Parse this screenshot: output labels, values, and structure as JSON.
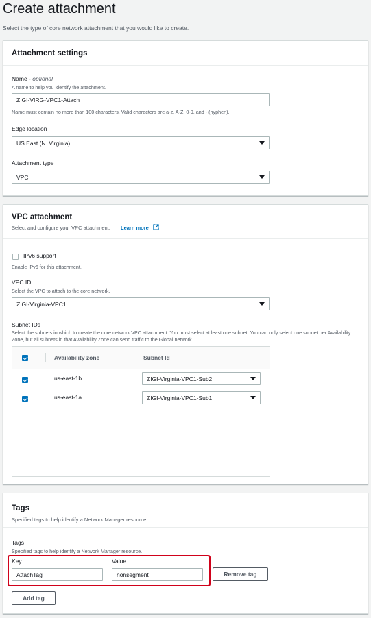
{
  "page": {
    "title": "Create attachment",
    "description": "Select the type of core network attachment that you would like to create."
  },
  "settings": {
    "title": "Attachment settings",
    "name_label": "Name - ",
    "name_optional": "optional",
    "name_hint": "A name to help you identify the attachment.",
    "name_value": "ZIGI-VIRG-VPC1-Attach",
    "name_constraint": "Name must contain no more than 100 characters. Valid characters are a-z, A-Z, 0-9, and - (hyphen).",
    "edge_label": "Edge location",
    "edge_value": "US East (N. Virginia)",
    "type_label": "Attachment type",
    "type_value": "VPC"
  },
  "vpc": {
    "title": "VPC attachment",
    "subtitle": "Select and configure your VPC attachment.",
    "learn_more": "Learn more",
    "ipv6_label": "IPv6 support",
    "ipv6_hint": "Enable IPv6 for this attachment.",
    "vpc_id_label": "VPC ID",
    "vpc_id_hint": "Select the VPC to attach to the core network.",
    "vpc_id_value": "ZIGI-Virginia-VPC1",
    "subnet_label": "Subnet IDs",
    "subnet_hint": "Select the subnets in which to create the core network VPC attachment. You must select at least one subnet. You can only select one subnet per Availability Zone, but all subnets in that Availability Zone can send traffic to the Global network.",
    "columns": [
      "Availability zone",
      "Subnet Id"
    ],
    "rows": [
      {
        "zone": "us-east-1b",
        "subnet": "ZIGI-Virginia-VPC1-Sub2",
        "checked": true
      },
      {
        "zone": "us-east-1a",
        "subnet": "ZIGI-Virginia-VPC1-Sub1",
        "checked": true
      }
    ]
  },
  "tags": {
    "title": "Tags",
    "subtitle": "Specified tags to help identify a Network Manager resource.",
    "inner_label": "Tags",
    "inner_hint": "Specified tags to help identify a Network Manager resource.",
    "key_label": "Key",
    "value_label": "Value",
    "key_value": "AttachTag",
    "value_value": "nonsegment",
    "remove_label": "Remove tag",
    "add_label": "Add tag"
  },
  "colors": {
    "accent": "#0073bb",
    "highlight": "#d0021b"
  }
}
